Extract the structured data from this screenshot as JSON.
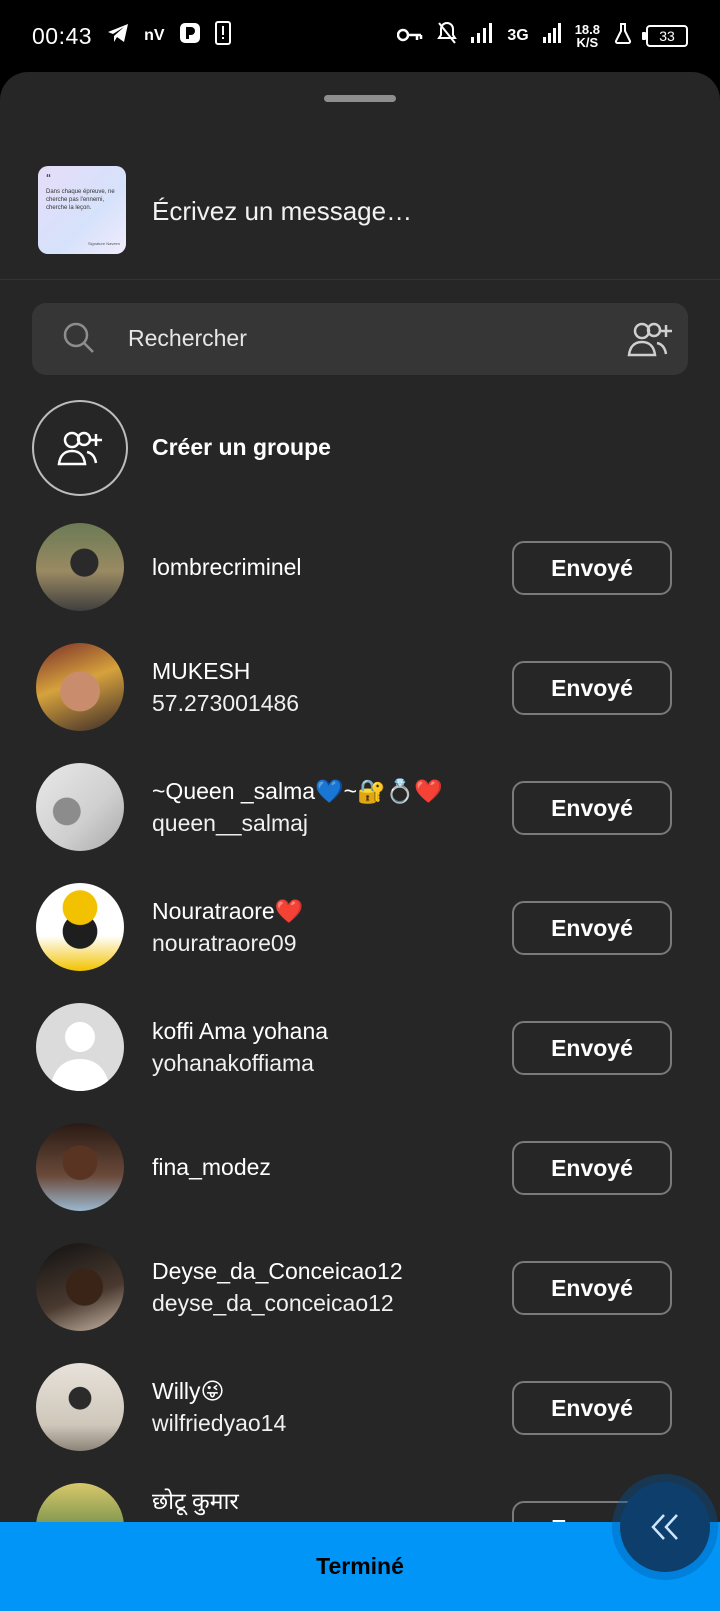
{
  "status_bar": {
    "time": "00:43",
    "nv": "nV",
    "net_type": "3G",
    "speed_value": "18.8",
    "speed_unit": "K/S",
    "battery": "33"
  },
  "compose": {
    "placeholder": "Écrivez un message…",
    "thumb_quote": "“",
    "thumb_text": "Dans chaque épreuve, ne cherche pas l'ennemi, cherche la leçon.",
    "thumb_sign": "Signature Naveen"
  },
  "search": {
    "placeholder": "Rechercher"
  },
  "create_group": {
    "label": "Créer un groupe"
  },
  "contacts": [
    {
      "name": "lombrecriminel",
      "username": "",
      "button": "Envoyé"
    },
    {
      "name": "MUKESH",
      "username": "57.273001486",
      "button": "Envoyé"
    },
    {
      "name": "~Queen _salma💙~🔐💍❤️",
      "username": "queen__salmaj",
      "button": "Envoyé"
    },
    {
      "name": "Nouratraore❤️",
      "username": "nouratraore09",
      "button": "Envoyé"
    },
    {
      "name": "koffi Ama yohana",
      "username": "yohanakoffiama",
      "button": "Envoyé"
    },
    {
      "name": "fina_modez",
      "username": "",
      "button": "Envoyé"
    },
    {
      "name": "Deyse_da_Conceicao12",
      "username": "deyse_da_conceicao12",
      "button": "Envoyé"
    },
    {
      "name": "Willy😜",
      "username": "wilfriedyao14",
      "button": "Envoyé"
    },
    {
      "name": "छोटू कुमार",
      "username": "",
      "button": "Envoyé"
    }
  ],
  "footer": {
    "done_label": "Terminé"
  },
  "colors": {
    "sheet_bg": "#262626",
    "accent": "#0095f6"
  }
}
